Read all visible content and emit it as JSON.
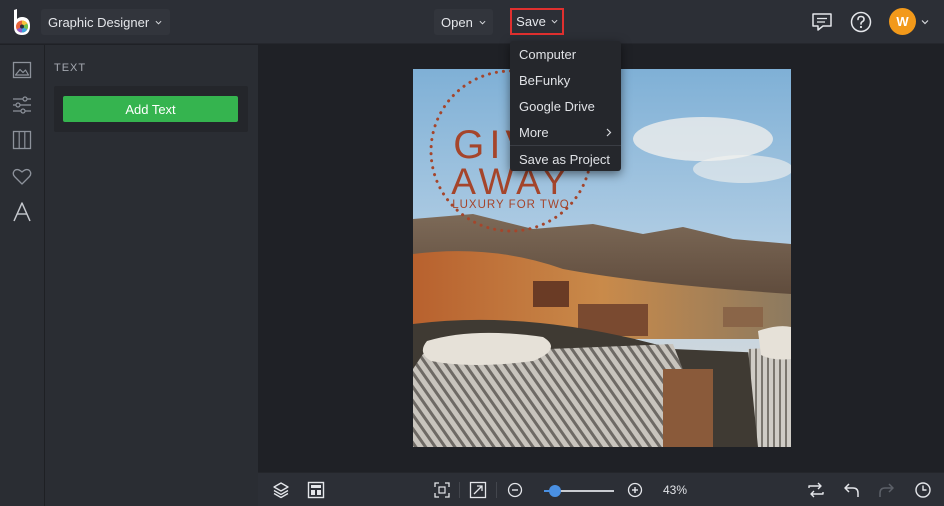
{
  "header": {
    "app_mode": "Graphic Designer",
    "open_label": "Open",
    "save_label": "Save",
    "user_initial": "W",
    "accent_highlight": "#e0302f",
    "avatar_color": "#f2991a"
  },
  "save_menu": {
    "items": [
      "Computer",
      "BeFunky",
      "Google Drive",
      "More",
      "Save as Project"
    ]
  },
  "sidebar": {
    "icons": [
      "image-icon",
      "sliders-icon",
      "layout-columns-icon",
      "heart-icon",
      "text-icon"
    ]
  },
  "panel": {
    "title": "TEXT",
    "add_text_label": "Add Text",
    "button_color": "#35b44f"
  },
  "canvas": {
    "headline_line1": "GIVE",
    "headline_line2": "AWAY",
    "subline": "LUXURY FOR TWO"
  },
  "footer": {
    "zoom_value": 43,
    "zoom_label": "43%"
  }
}
